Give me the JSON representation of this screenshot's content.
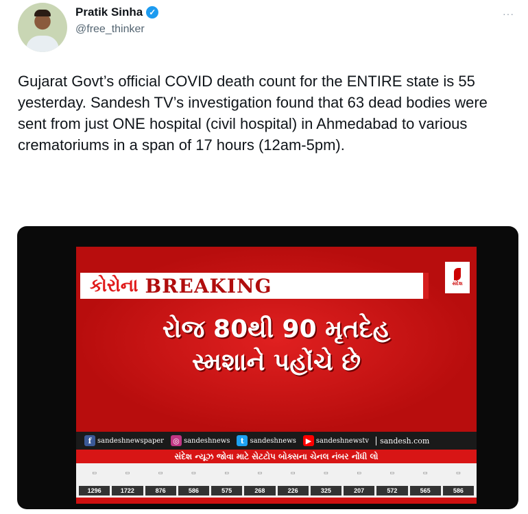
{
  "author": {
    "name": "Pratik Sinha",
    "handle": "@free_thinker",
    "verified_icon": "✓"
  },
  "more_icon": "···",
  "tweet": {
    "text": "Gujarat Govt’s official COVID death count for the ENTIRE state is 55 yesterday. Sandesh TV’s investigation found that 63 dead bodies were sent from just ONE hospital (civil hospital) in Ahmedabad to various crematoriums in a span of 17 hours (12am-5pm)."
  },
  "media": {
    "kicker": "કોરોના",
    "breaking": "BREAKING",
    "logo_text": "સંદેશ",
    "headline_line1": "રોજ 80થી 90 મૃતદેહ",
    "headline_line2": "સ્મશાને પહોંચે છે",
    "social": [
      {
        "icon": "f",
        "icon_name": "facebook-icon",
        "color": "#3b5998",
        "label": "sandeshnewspaper"
      },
      {
        "icon": "◎",
        "icon_name": "instagram-icon",
        "color": "#c13584",
        "label": "sandeshnews"
      },
      {
        "icon": "t",
        "icon_name": "twitter-icon",
        "color": "#1da1f2",
        "label": "sandeshnews"
      },
      {
        "icon": "▶",
        "icon_name": "youtube-icon",
        "color": "#ff0000",
        "label": "sandeshnewstv"
      }
    ],
    "site": "sandesh.com",
    "strip_text": "સંદેશ ન્યૂઝ જોવા માટે સેટટોપ બોક્સના ચેનલ નંબર નોંધી લો",
    "channel_numbers": [
      "1296",
      "1722",
      "876",
      "586",
      "575",
      "268",
      "226",
      "325",
      "207",
      "572",
      "565",
      "586"
    ]
  }
}
